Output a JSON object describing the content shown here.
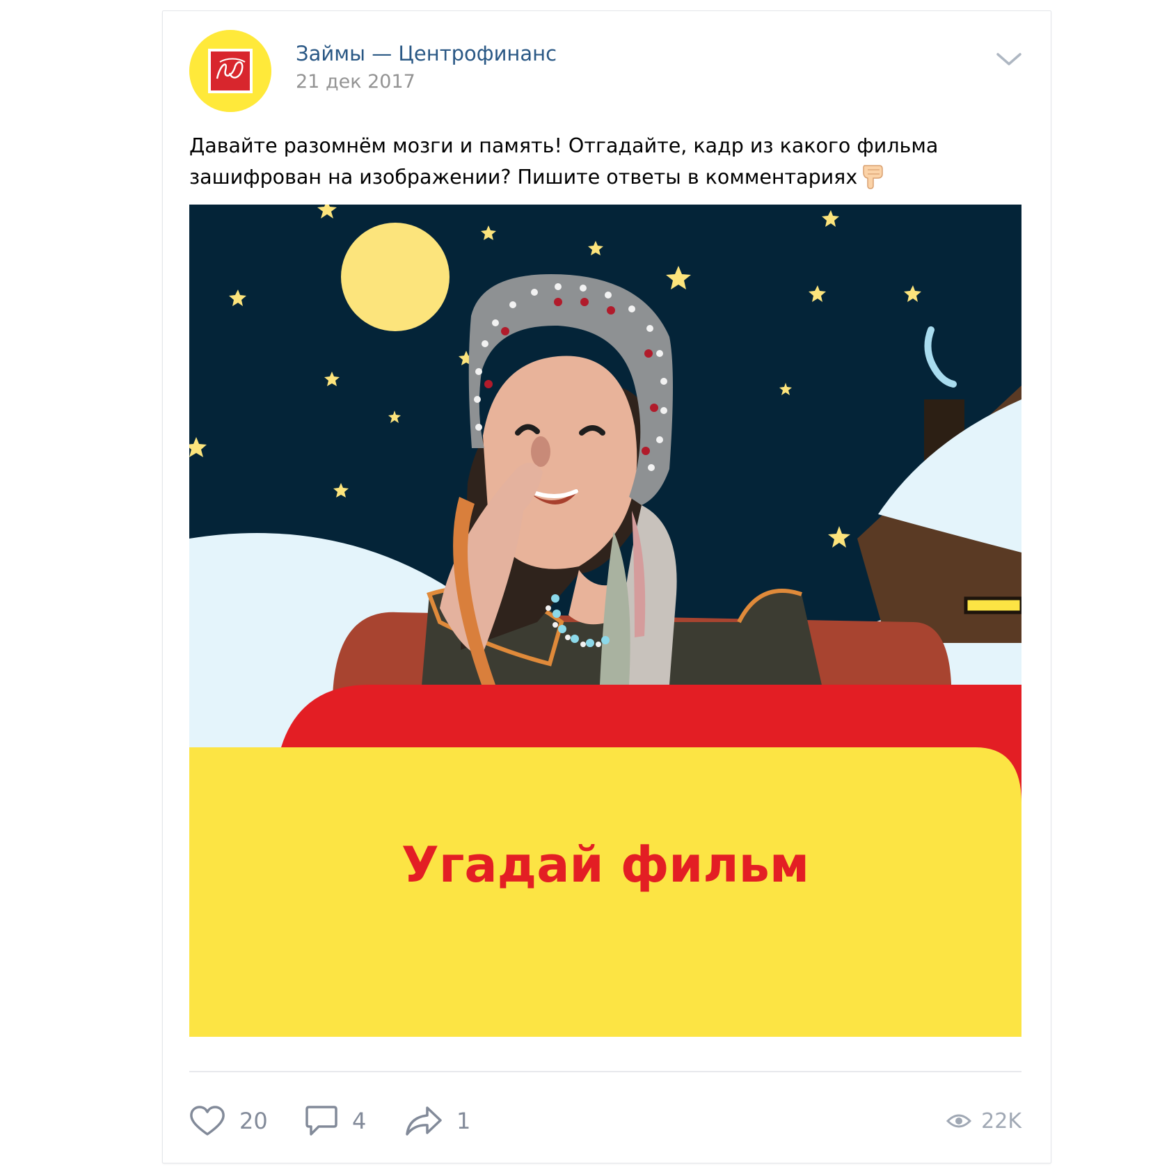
{
  "post": {
    "author": "Займы — Центрофинанс",
    "date": "21 дек 2017",
    "text": "Давайте разомнём мозги и память! Отгадайте, кадр из какого фильма\nзашифрован на изображении? Пишите ответы в комментариях",
    "text_emoji": "pointing-down-hand-icon",
    "image_caption": "Угадай фильм"
  },
  "actions": {
    "likes": "20",
    "comments": "4",
    "shares": "1",
    "views": "22K"
  },
  "colors": {
    "link": "#2a5885",
    "muted": "#939393",
    "night_sky": "#042438",
    "moon": "#fce47c",
    "banner_red": "#e31e24",
    "banner_yellow": "#fce444"
  }
}
